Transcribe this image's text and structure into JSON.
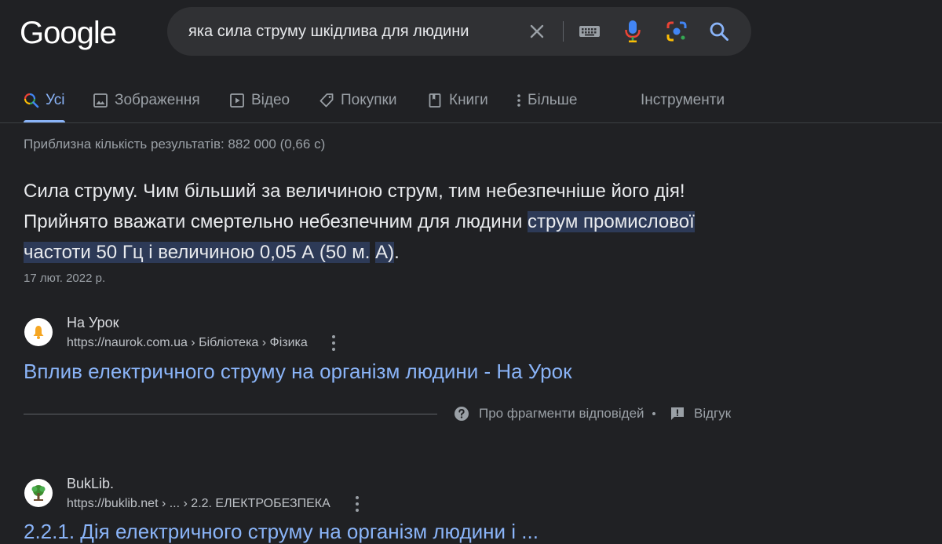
{
  "header": {
    "logo": "Google",
    "search": {
      "query": "яка сила струму шкідлива для людини"
    }
  },
  "tabs": [
    {
      "label": "Усі",
      "active": true
    },
    {
      "label": "Зображення"
    },
    {
      "label": "Відео"
    },
    {
      "label": "Покупки"
    },
    {
      "label": "Книги"
    },
    {
      "label": "Більше"
    },
    {
      "label": "Інструменти"
    }
  ],
  "results_stats": "Приблизна кількість результатів: 882 000 (0,66 с)",
  "featured_snippet": {
    "text_plain": "Сила струму. Чим більший за величиною струм, тим небезпечніше його дія! Прийнято вважати смертельно небезпечним для людини ",
    "text_highlight_1": "струм промислової частоти 50 Гц і величиною 0,05 А (50 м.",
    "text_highlight_2": "А)",
    "text_end": ".",
    "date": "17 лют. 2022 р.",
    "source": {
      "name": "На Урок",
      "url": "https://naurok.com.ua › Бібліотека › Фізика",
      "title": "Вплив електричного струму на організм людини - На Урок"
    },
    "feedback": {
      "about_label": "Про фрагменти відповідей",
      "feedback_label": "Відгук"
    }
  },
  "results": [
    {
      "name": "BukLib.",
      "url": "https://buklib.net › ... › 2.2. ЕЛЕКТРОБЕЗПЕКА",
      "title": "2.2.1. Дія електричного струму на організм людини і ..."
    }
  ],
  "colors": {
    "background": "#202124",
    "link": "#8ab4f8",
    "highlight": "#2d3a57",
    "muted": "#9aa0a6"
  }
}
